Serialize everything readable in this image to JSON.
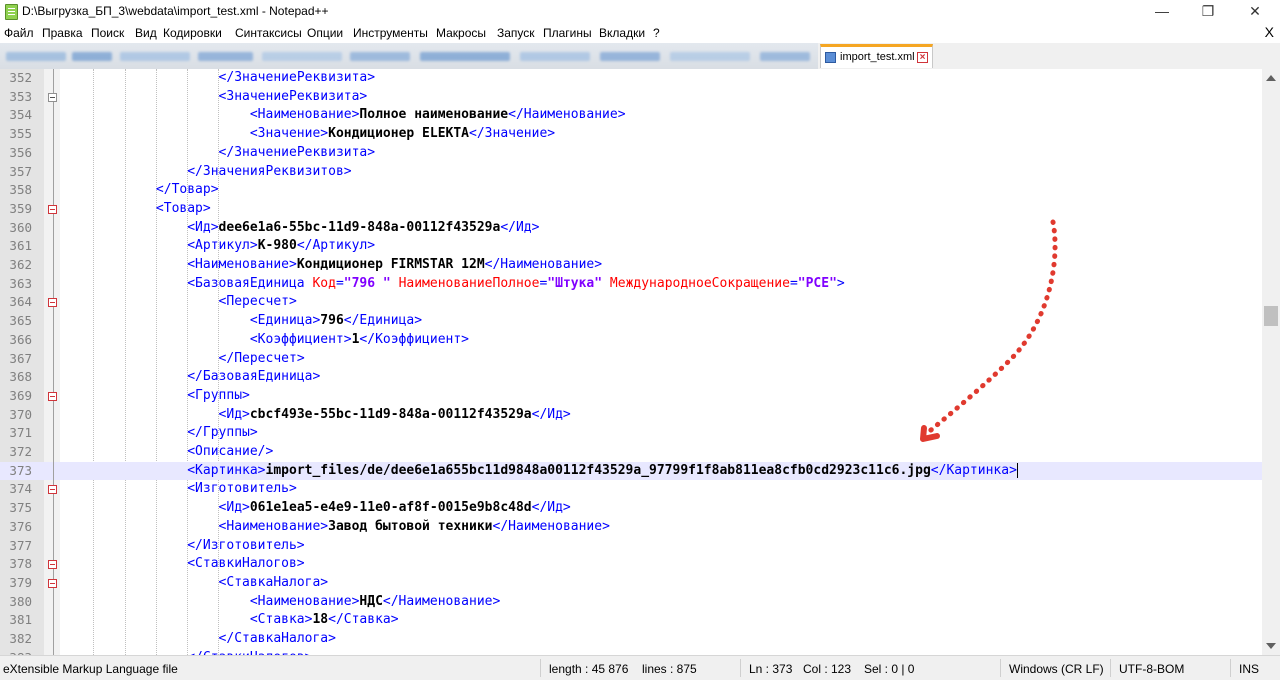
{
  "window": {
    "title": "D:\\Выгрузка_БП_3\\webdata\\import_test.xml - Notepad++",
    "minimize": "—",
    "maximize": "❐",
    "close": "✕"
  },
  "menu": {
    "items": [
      "Файл",
      "Правка",
      "Поиск",
      "Вид",
      "Кодировки",
      "Синтаксисы",
      "Опции",
      "Инструменты",
      "Макросы",
      "Запуск",
      "Плагины",
      "Вкладки",
      "?"
    ],
    "close": "X"
  },
  "tabs": [
    {
      "label": "import_test.xml",
      "active": true
    }
  ],
  "editor": {
    "active_line": 373,
    "lines": [
      {
        "n": "352",
        "indent": 5,
        "seg": [
          [
            "t",
            "</ЗначениеРеквизита>"
          ]
        ]
      },
      {
        "n": "353",
        "indent": 5,
        "seg": [
          [
            "t",
            "<ЗначениеРеквизита>"
          ]
        ]
      },
      {
        "n": "354",
        "indent": 6,
        "seg": [
          [
            "t",
            "<Наименование>"
          ],
          [
            "c",
            "Полное наименование"
          ],
          [
            "t",
            "</Наименование>"
          ]
        ]
      },
      {
        "n": "355",
        "indent": 6,
        "seg": [
          [
            "t",
            "<Значение>"
          ],
          [
            "c",
            "Кондиционер ELEKTA"
          ],
          [
            "t",
            "</Значение>"
          ]
        ]
      },
      {
        "n": "356",
        "indent": 5,
        "seg": [
          [
            "t",
            "</ЗначениеРеквизита>"
          ]
        ]
      },
      {
        "n": "357",
        "indent": 4,
        "seg": [
          [
            "t",
            "</ЗначенияРеквизитов>"
          ]
        ]
      },
      {
        "n": "358",
        "indent": 3,
        "seg": [
          [
            "t",
            "</Товар>"
          ]
        ]
      },
      {
        "n": "359",
        "indent": 3,
        "seg": [
          [
            "t",
            "<Товар>"
          ]
        ]
      },
      {
        "n": "360",
        "indent": 4,
        "seg": [
          [
            "t",
            "<Ид>"
          ],
          [
            "c",
            "dee6e1a6-55bc-11d9-848a-00112f43529a"
          ],
          [
            "t",
            "</Ид>"
          ]
        ]
      },
      {
        "n": "361",
        "indent": 4,
        "seg": [
          [
            "t",
            "<Артикул>"
          ],
          [
            "c",
            "К-980"
          ],
          [
            "t",
            "</Артикул>"
          ]
        ]
      },
      {
        "n": "362",
        "indent": 4,
        "seg": [
          [
            "t",
            "<Наименование>"
          ],
          [
            "c",
            "Кондиционер FIRMSTAR 12М"
          ],
          [
            "t",
            "</Наименование>"
          ]
        ]
      },
      {
        "n": "363",
        "indent": 4,
        "seg": [
          [
            "t",
            "<БазоваяЕдиница "
          ],
          [
            "a",
            "Код"
          ],
          [
            "t",
            "="
          ],
          [
            "v",
            "\"796 \""
          ],
          [
            "a",
            " НаименованиеПолное"
          ],
          [
            "t",
            "="
          ],
          [
            "v",
            "\"Штука\""
          ],
          [
            "a",
            " МеждународноеСокращение"
          ],
          [
            "t",
            "="
          ],
          [
            "v",
            "\"PCE\""
          ],
          [
            "t",
            ">"
          ]
        ]
      },
      {
        "n": "364",
        "indent": 5,
        "seg": [
          [
            "t",
            "<Пересчет>"
          ]
        ]
      },
      {
        "n": "365",
        "indent": 6,
        "seg": [
          [
            "t",
            "<Единица>"
          ],
          [
            "c",
            "796"
          ],
          [
            "t",
            "</Единица>"
          ]
        ]
      },
      {
        "n": "366",
        "indent": 6,
        "seg": [
          [
            "t",
            "<Коэффициент>"
          ],
          [
            "c",
            "1"
          ],
          [
            "t",
            "</Коэффициент>"
          ]
        ]
      },
      {
        "n": "367",
        "indent": 5,
        "seg": [
          [
            "t",
            "</Пересчет>"
          ]
        ]
      },
      {
        "n": "368",
        "indent": 4,
        "seg": [
          [
            "t",
            "</БазоваяЕдиница>"
          ]
        ]
      },
      {
        "n": "369",
        "indent": 4,
        "seg": [
          [
            "t",
            "<Группы>"
          ]
        ]
      },
      {
        "n": "370",
        "indent": 5,
        "seg": [
          [
            "t",
            "<Ид>"
          ],
          [
            "c",
            "cbcf493e-55bc-11d9-848a-00112f43529a"
          ],
          [
            "t",
            "</Ид>"
          ]
        ]
      },
      {
        "n": "371",
        "indent": 4,
        "seg": [
          [
            "t",
            "</Группы>"
          ]
        ]
      },
      {
        "n": "372",
        "indent": 4,
        "seg": [
          [
            "t",
            "<Описание/>"
          ]
        ]
      },
      {
        "n": "373",
        "indent": 4,
        "seg": [
          [
            "t",
            "<Картинка>"
          ],
          [
            "c",
            "import_files/de/dee6e1a655bc11d9848a00112f43529a_97799f1f8ab811ea8cfb0cd2923c11c6.jpg"
          ],
          [
            "t",
            "</Картинка>"
          ]
        ]
      },
      {
        "n": "374",
        "indent": 4,
        "seg": [
          [
            "t",
            "<Изготовитель>"
          ]
        ]
      },
      {
        "n": "375",
        "indent": 5,
        "seg": [
          [
            "t",
            "<Ид>"
          ],
          [
            "c",
            "061e1ea5-e4e9-11e0-af8f-0015e9b8c48d"
          ],
          [
            "t",
            "</Ид>"
          ]
        ]
      },
      {
        "n": "376",
        "indent": 5,
        "seg": [
          [
            "t",
            "<Наименование>"
          ],
          [
            "c",
            "Завод бытовой техники"
          ],
          [
            "t",
            "</Наименование>"
          ]
        ]
      },
      {
        "n": "377",
        "indent": 4,
        "seg": [
          [
            "t",
            "</Изготовитель>"
          ]
        ]
      },
      {
        "n": "378",
        "indent": 4,
        "seg": [
          [
            "t",
            "<СтавкиНалогов>"
          ]
        ]
      },
      {
        "n": "379",
        "indent": 5,
        "seg": [
          [
            "t",
            "<СтавкаНалога>"
          ]
        ]
      },
      {
        "n": "380",
        "indent": 6,
        "seg": [
          [
            "t",
            "<Наименование>"
          ],
          [
            "c",
            "НДС"
          ],
          [
            "t",
            "</Наименование>"
          ]
        ]
      },
      {
        "n": "381",
        "indent": 6,
        "seg": [
          [
            "t",
            "<Ставка>"
          ],
          [
            "c",
            "18"
          ],
          [
            "t",
            "</Ставка>"
          ]
        ]
      },
      {
        "n": "382",
        "indent": 5,
        "seg": [
          [
            "t",
            "</СтавкаНалога>"
          ]
        ]
      },
      {
        "n": "383",
        "indent": 4,
        "seg": [
          [
            "t",
            "</СтавкиНалогов>"
          ]
        ]
      }
    ]
  },
  "status": {
    "file_type": "eXtensible Markup Language file",
    "length": "length : 45 876",
    "lines": "lines : 875",
    "ln": "Ln : 373",
    "col": "Col : 123",
    "sel": "Sel : 0 | 0",
    "eol": "Windows (CR LF)",
    "encoding": "UTF-8-BOM",
    "mode": "INS"
  },
  "colors": {
    "tag": "#0000ff",
    "attribute": "#ff0000",
    "attribute_value": "#8000ff",
    "content": "#000000",
    "active_line": "#e8e8ff",
    "annotation_arrow": "#e03a2f",
    "tab_accent": "#f5a623"
  }
}
